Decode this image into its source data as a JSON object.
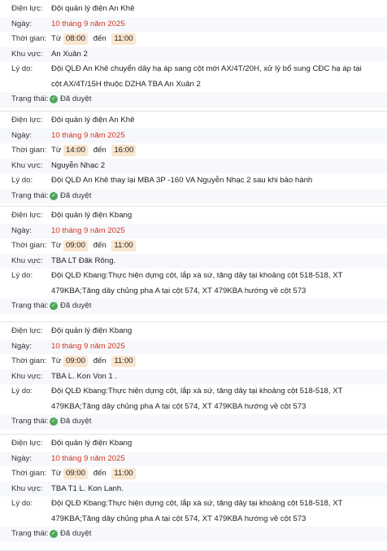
{
  "labels": {
    "unit": "Điện lực:",
    "date": "Ngày:",
    "time": "Thời gian:",
    "area": "Khu vực:",
    "reason": "Lý do:",
    "status": "Trạng thái:",
    "from": "Từ",
    "to": "đến"
  },
  "records": [
    {
      "unit": "Đội quản lý điện An Khê",
      "date": "10 tháng 9 năm 2025",
      "start": "08:00",
      "end": "11:00",
      "area": "An Xuân 2",
      "reason": "Đội QLĐ An Khê chuyển dây hạ áp sang cột mới AX/4T/20H, xử lý bổ sung CĐC hạ áp tại cột AX/4T/15H thuộc DZHA TBA An Xuân 2",
      "status": "Đã duyệt"
    },
    {
      "unit": "Đội quản lý điện An Khê",
      "date": "10 tháng 9 năm 2025",
      "start": "14:00",
      "end": "16:00",
      "area": "Nguyễn Nhạc 2",
      "reason": "Đội QLĐ An Khê thay lại MBA 3P -160 VA Nguyễn Nhạc 2 sau khi bảo hành",
      "status": "Đã duyệt"
    },
    {
      "unit": "Đội quản lý điện Kbang",
      "date": "10 tháng 9 năm 2025",
      "start": "09:00",
      "end": "11:00",
      "area": "TBA LT Đăk Rông.",
      "reason": "Đội QLĐ Kbang:Thực hiện dựng cột, lắp xà sứ, tăng dây tại khoảng cột 518-518, XT 479KBA;Tăng dây chủng pha A tại cột 574, XT 479KBA hướng về cột 573",
      "status": "Đã duyệt"
    },
    {
      "unit": "Đội quản lý điện Kbang",
      "date": "10 tháng 9 năm 2025",
      "start": "09:00",
      "end": "11:00",
      "area": "TBA L. Kon Von 1 .",
      "reason": "Đội QLĐ Kbang:Thực hiện dựng cột, lắp xà sứ, tăng dây tại khoảng cột 518-518, XT 479KBA;Tăng dây chủng pha A tại cột 574, XT 479KBA hướng về cột 573",
      "status": "Đã duyệt"
    },
    {
      "unit": "Đội quản lý điện Kbang",
      "date": "10 tháng 9 năm 2025",
      "start": "09:00",
      "end": "11:00",
      "area": "TBA T1 L. Kon Lanh.",
      "reason": "Đội QLĐ Kbang:Thực hiện dựng cột, lắp xà sứ, tăng dây tại khoảng cột 518-518, XT 479KBA;Tăng dây chủng pha A tại cột 574, XT 479KBA hướng về cột 573",
      "status": "Đã duyệt"
    }
  ],
  "colors": {
    "date_text": "#d8321c",
    "time_chip_bg": "#fbe6cf",
    "status_check": "#4ea45a",
    "stripe": "#f6f8fc",
    "divider": "#e3e3e3"
  },
  "icons": {
    "status": "check-circle-icon"
  }
}
